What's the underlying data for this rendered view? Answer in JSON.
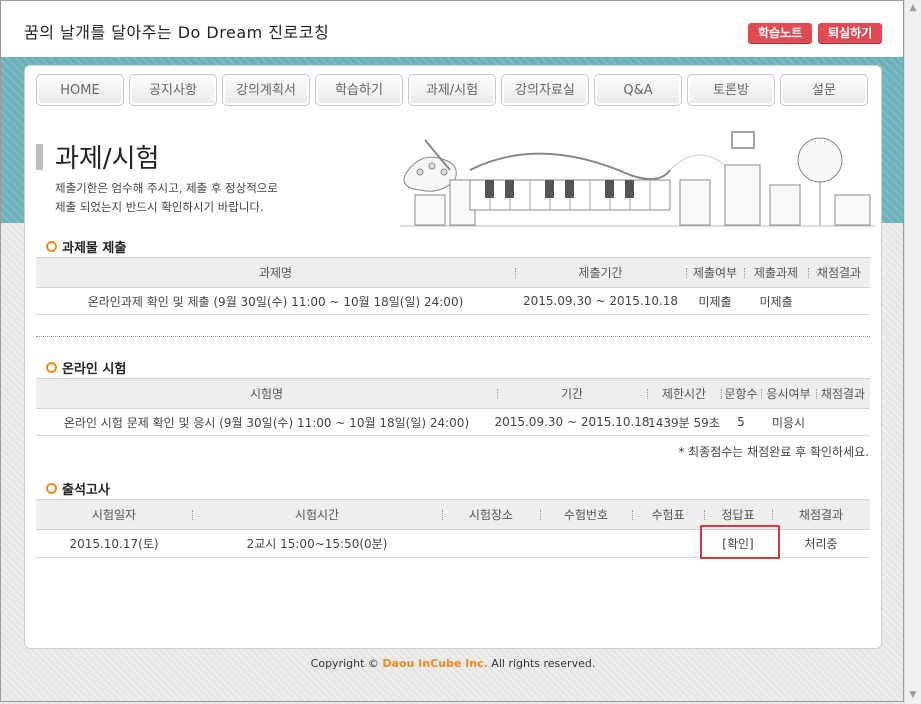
{
  "header": {
    "title": "꿈의 날개를 달아주는 Do Dream 진로코칭",
    "study_note_label": "학습노트",
    "logout_label": "퇴실하기"
  },
  "nav": {
    "tabs": [
      "HOME",
      "공지사항",
      "강의계획서",
      "학습하기",
      "과제/시험",
      "강의자료실",
      "Q&A",
      "토론방",
      "설문"
    ]
  },
  "page": {
    "title": "과제/시험",
    "description": "제출기한은 엄수해 주시고, 제출 후 정상적으로\n제출 되었는지 반드시 확인하시기 바랍니다."
  },
  "assignments": {
    "section_title": "과제물 제출",
    "headers": [
      "과제명",
      "제출기간",
      "제출여부",
      "제출과제",
      "채점결과"
    ],
    "rows": [
      [
        "온라인과제 확인 및 제출 (9월 30일(수) 11:00 ~ 10월 18일(일) 24:00)",
        "2015.09.30 ~ 2015.10.18",
        "미제출",
        "미제출",
        ""
      ]
    ]
  },
  "exams": {
    "section_title": "온라인 시험",
    "headers": [
      "시험명",
      "기간",
      "제한시간",
      "문항수",
      "응시여부",
      "채점결과"
    ],
    "rows": [
      [
        "온라인 시험 문제 확인 및 응시 (9월 30일(수) 11:00 ~ 10월 18일(일) 24:00)",
        "2015.09.30 ~ 2015.10.18",
        "1439분 59초",
        "5",
        "미응시",
        ""
      ]
    ],
    "note": "* 최종점수는 채점완료 후 확인하세요."
  },
  "attendance": {
    "section_title": "출석고사",
    "headers": [
      "시험일자",
      "시험시간",
      "시험장소",
      "수험번호",
      "수험표",
      "정답표",
      "채점결과"
    ],
    "rows": [
      [
        "2015.10.17(토)",
        "2교시 15:00~15:50(0분)",
        "",
        "",
        "",
        "[확인]",
        "처리중"
      ]
    ]
  },
  "footer": {
    "prefix": "Copyright ©",
    "brand": "Daou InCube Inc.",
    "suffix": "All rights reserved."
  },
  "colors": {
    "accent_red": "#e04a52",
    "teal_band": "#6bb3bc",
    "bullet_orange": "#f08a1c",
    "highlight_box": "#d9383f"
  }
}
